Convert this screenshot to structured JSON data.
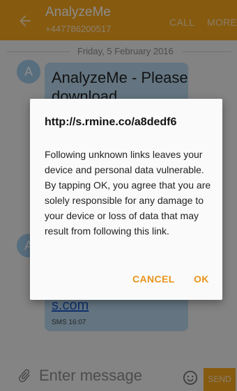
{
  "header": {
    "title": "AnalyzeMe",
    "phone": "+447786200517",
    "call_label": "CALL",
    "more_label": "MORE",
    "back_icon": "back-arrow-icon"
  },
  "conversation": {
    "date_separator": "Friday, 5 February 2016",
    "avatar_letter": "A",
    "message_preview": "AnalyzeMe - Please download",
    "message_link_fragment": "s.com",
    "message_meta": "SMS 16:07"
  },
  "composer": {
    "placeholder": "Enter message",
    "send_label": "SEND",
    "attach_icon": "paperclip-icon",
    "emoji_icon": "smiley-icon"
  },
  "dialog": {
    "title": "http://s.rmine.co/a8dedf6",
    "body": "Following unknown links leaves your device and personal data vulnerable. By tapping OK, you agree that you are solely responsible for any damage to your device or loss of data that may result from following this link.",
    "cancel_label": "CANCEL",
    "ok_label": "OK"
  },
  "colors": {
    "accent": "#f4a51c",
    "bubble": "#b6d6ec",
    "link": "#1a56c9",
    "dialog_button": "#e8941a"
  }
}
